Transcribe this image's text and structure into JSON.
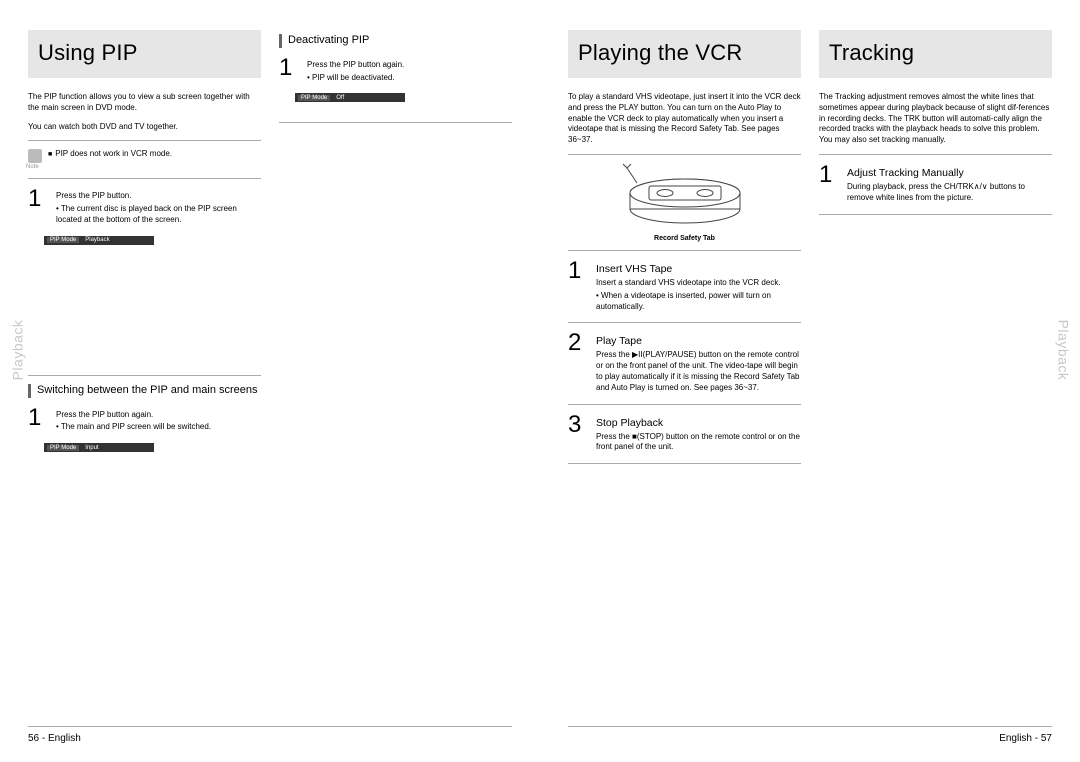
{
  "left": {
    "side_tab": "Playback",
    "footer": "56 - English",
    "col1": {
      "title": "Using PIP",
      "intro1": "The PIP function allows you to view a sub screen together with the main screen in DVD mode.",
      "intro2": "You can watch both DVD and TV together.",
      "note_label": "Note",
      "note_text": "PIP does not work in VCR mode.",
      "step1_text": "Press the PIP button.",
      "step1_bullet": "• The current disc is played back on the PIP screen located at the bottom of the screen.",
      "pipbar1_mode": "PIP Mode",
      "pipbar1_val": "Playback",
      "sub_heading": "Switching between the PIP and main screens",
      "step2_text": "Press the PIP button again.",
      "step2_bullet": "• The main and PIP screen will be switched.",
      "pipbar2_mode": "PIP Mode",
      "pipbar2_val": "Input"
    },
    "col2": {
      "sub_heading": "Deactivating PIP",
      "step1_text": "Press the PIP button again.",
      "step1_bullet": "• PIP will be deactivated.",
      "pipbar_mode": "PIP Mode",
      "pipbar_val": "Off"
    }
  },
  "right": {
    "side_tab": "Playback",
    "footer": "English - 57",
    "col1": {
      "title": "Playing the VCR",
      "intro": "To play a standard VHS videotape, just insert it into the VCR deck and press the PLAY button. You can turn on the Auto Play to enable the VCR deck to play automatically when you insert a videotape that is missing the Record Safety Tab. See pages 36~37.",
      "tape_caption": "Record Safety Tab",
      "step1_title": "Insert VHS Tape",
      "step1_text": "Insert a standard VHS videotape into the VCR deck.",
      "step1_bullet": "• When a videotape is inserted, power will turn on automatically.",
      "step2_title": "Play Tape",
      "step2_text": "Press the ▶II(PLAY/PAUSE) button on the remote control or on the front panel of the unit. The video-tape will begin to play automatically if it is missing the Record Safety Tab and Auto Play is turned on. See pages 36~37.",
      "step3_title": "Stop Playback",
      "step3_text": "Press the ■(STOP) button on the remote control or on the front panel of the unit."
    },
    "col2": {
      "title": "Tracking",
      "intro": "The Tracking adjustment removes almost the white lines that sometimes appear during playback because of slight dif-ferences in recording decks. The TRK button will automati-cally align the recorded tracks with the playback heads to solve this problem. You may also set tracking manually.",
      "step1_title": "Adjust Tracking Manually",
      "step1_text": "During playback, press the CH/TRK∧/∨ buttons to remove white lines from the picture."
    }
  }
}
